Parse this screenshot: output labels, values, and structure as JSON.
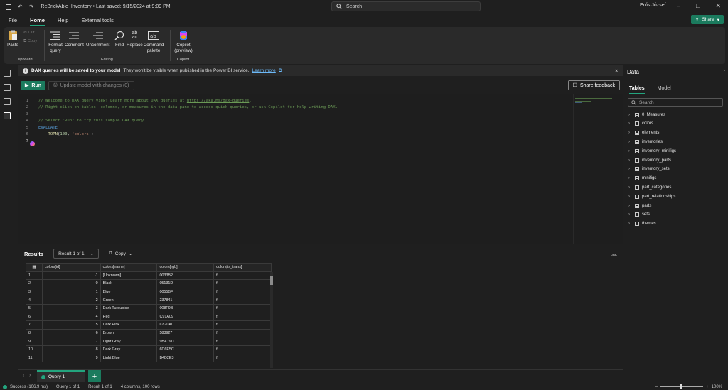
{
  "titlebar": {
    "title": "ReBrickAble_Inventory • Last saved: 9/15/2024 at 9:09 PM",
    "search_placeholder": "Search",
    "user": "Erős József"
  },
  "menu": {
    "items": [
      "File",
      "Home",
      "Help",
      "External tools"
    ],
    "active": "Home",
    "share_label": "Share"
  },
  "ribbon": {
    "paste": "Paste",
    "cut": "Cut",
    "copy": "Copy",
    "clipboard_group": "Clipboard",
    "format_query": "Format query",
    "comment": "Comment",
    "uncomment": "Uncomment",
    "find": "Find",
    "replace": "Replace",
    "command_palette": "Command palette",
    "editing_group": "Editing",
    "copilot": "Copilot (preview)",
    "copilot_group": "Copilot"
  },
  "banner": {
    "bold": "DAX queries will be saved to your model",
    "text": "They won't be visible when published in the Power BI service.",
    "link": "Learn more"
  },
  "toolbar": {
    "run": "Run",
    "update": "Update model with changes (0)",
    "feedback": "Share feedback"
  },
  "editor": {
    "lines": [
      {
        "n": "1",
        "parts": [
          {
            "c": "cmt",
            "t": "// Welcome to DAX query view! Learn more about DAX queries at "
          },
          {
            "c": "cmt ul",
            "t": "https://aka.ms/dax-queries"
          },
          {
            "c": "cmt",
            "t": "."
          }
        ]
      },
      {
        "n": "2",
        "parts": [
          {
            "c": "cmt",
            "t": "// Right-click on tables, columns, or measures in the data pane to access quick queries, or ask Copilot for help writing DAX."
          }
        ]
      },
      {
        "n": "3",
        "parts": []
      },
      {
        "n": "4",
        "parts": [
          {
            "c": "cmt",
            "t": "// Select \"Run\" to try this sample DAX query."
          }
        ]
      },
      {
        "n": "5",
        "parts": [
          {
            "c": "kw",
            "t": "EVALUATE"
          }
        ]
      },
      {
        "n": "6",
        "parts": [
          {
            "c": "",
            "t": "    "
          },
          {
            "c": "fn",
            "t": "TOPN"
          },
          {
            "c": "",
            "t": "("
          },
          {
            "c": "num",
            "t": "100"
          },
          {
            "c": "",
            "t": ", "
          },
          {
            "c": "str",
            "t": "'colors'"
          },
          {
            "c": "",
            "t": ")"
          }
        ]
      },
      {
        "n": "7",
        "parts": []
      }
    ]
  },
  "results": {
    "title": "Results",
    "selector": "Result 1 of 1",
    "copy": "Copy",
    "columns": [
      "colors[id]",
      "colors[name]",
      "colors[rgb]",
      "colors[is_trans]"
    ],
    "rows": [
      [
        "1",
        "-1",
        "[Unknown]",
        "0033B2",
        "f"
      ],
      [
        "2",
        "0",
        "Black",
        "05131D",
        "f"
      ],
      [
        "3",
        "1",
        "Blue",
        "0055BF",
        "f"
      ],
      [
        "4",
        "2",
        "Green",
        "237841",
        "f"
      ],
      [
        "5",
        "3",
        "Dark Turquoise",
        "008F9B",
        "f"
      ],
      [
        "6",
        "4",
        "Red",
        "C91A09",
        "f"
      ],
      [
        "7",
        "5",
        "Dark Pink",
        "C870A0",
        "f"
      ],
      [
        "8",
        "6",
        "Brown",
        "583927",
        "f"
      ],
      [
        "9",
        "7",
        "Light Gray",
        "9BA19D",
        "f"
      ],
      [
        "10",
        "8",
        "Dark Gray",
        "6D6E5C",
        "f"
      ],
      [
        "11",
        "9",
        "Light Blue",
        "B4D2E3",
        "f"
      ]
    ]
  },
  "tabs": {
    "query_tab": "Query 1",
    "add": "+"
  },
  "statusbar": {
    "success": "Success (106.9 ms)",
    "query": "Query 1 of 1",
    "result": "Result 1 of 1",
    "shape": "4 columns, 100 rows",
    "zoom": "100%"
  },
  "datapane": {
    "title": "Data",
    "tab_tables": "Tables",
    "tab_model": "Model",
    "search_placeholder": "Search",
    "tables": [
      "0_Measures",
      "colors",
      "elements",
      "inventories",
      "inventory_minifigs",
      "inventory_parts",
      "inventory_sets",
      "minifigs",
      "part_categories",
      "part_relationships",
      "parts",
      "sets",
      "themes"
    ]
  },
  "colors": {
    "accent": "#23a57e",
    "run_button": "#1b7b5e",
    "link": "#6cb8f6"
  }
}
